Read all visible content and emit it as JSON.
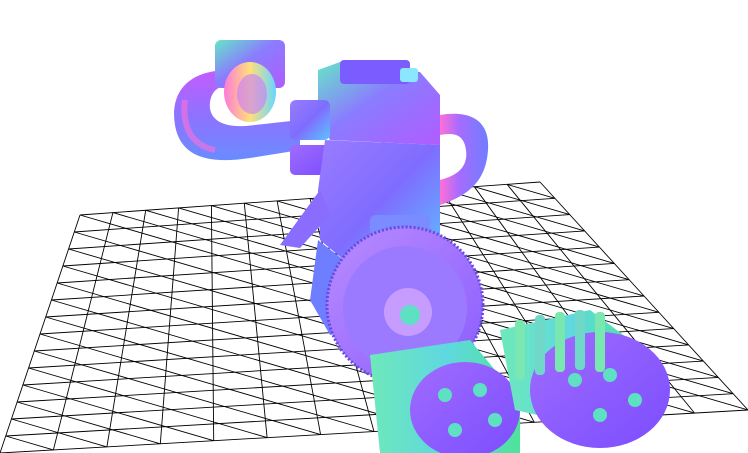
{
  "viewer": {
    "background_color": "#ffffff",
    "grid_line_color": "#000000",
    "model_render_mode": "normal-map",
    "model_colors": {
      "violet": "#8a6cff",
      "blue": "#6f7dff",
      "teal": "#5ee0c2",
      "green": "#4fe39a",
      "magenta": "#c45cff",
      "pink": "#ff6fd8",
      "cyan": "#67d6ff",
      "deep_purple": "#7b4dff"
    }
  }
}
